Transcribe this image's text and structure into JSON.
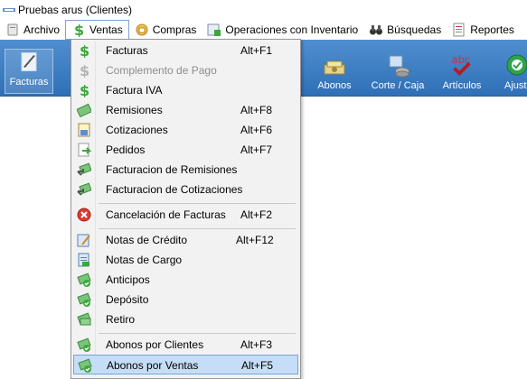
{
  "window": {
    "title": "Pruebas arus (Clientes)"
  },
  "menubar": {
    "items": [
      {
        "label": "Archivo",
        "icon": "archive-icon"
      },
      {
        "label": "Ventas",
        "icon": "dollar-icon"
      },
      {
        "label": "Compras",
        "icon": "shopping-icon"
      },
      {
        "label": "Operaciones con Inventario",
        "icon": "inventory-icon"
      },
      {
        "label": "Búsquedas",
        "icon": "binoculars-icon"
      },
      {
        "label": "Reportes",
        "icon": "report-icon"
      }
    ]
  },
  "toolbar": {
    "buttons": [
      {
        "label": "Facturas",
        "icon": "pen-icon"
      },
      {
        "label": "Abonos",
        "icon": "cash-icon"
      },
      {
        "label": "Corte / Caja",
        "icon": "register-icon"
      },
      {
        "label": "Artículos",
        "icon": "abc-check-icon"
      },
      {
        "label": "Ajust",
        "icon": "adjust-icon"
      }
    ]
  },
  "dropdown": {
    "items": [
      {
        "label": "Facturas",
        "shortcut": "Alt+F1",
        "icon": "dollar-icon"
      },
      {
        "label": "Complemento de Pago",
        "shortcut": "",
        "icon": "dollar-icon"
      },
      {
        "label": "Factura IVA",
        "shortcut": "",
        "icon": "dollar-icon"
      },
      {
        "label": "Remisiones",
        "shortcut": "Alt+F8",
        "icon": "bill-icon"
      },
      {
        "label": "Cotizaciones",
        "shortcut": "Alt+F6",
        "icon": "quote-icon"
      },
      {
        "label": "Pedidos",
        "shortcut": "Alt+F7",
        "icon": "order-icon"
      },
      {
        "label": "Facturacion de Remisiones",
        "shortcut": "",
        "icon": "convert-icon"
      },
      {
        "label": "Facturacion de Cotizaciones",
        "shortcut": "",
        "icon": "convert-icon"
      },
      {
        "label": "Cancelación de Facturas",
        "shortcut": "Alt+F2",
        "icon": "cancel-icon"
      },
      {
        "label": "Notas de Crédito",
        "shortcut": "Alt+F12",
        "icon": "credit-note-icon"
      },
      {
        "label": "Notas de Cargo",
        "shortcut": "",
        "icon": "charge-note-icon"
      },
      {
        "label": "Anticipos",
        "shortcut": "",
        "icon": "money-check-icon"
      },
      {
        "label": "Depósito",
        "shortcut": "",
        "icon": "money-check-icon"
      },
      {
        "label": "Retiro",
        "shortcut": "",
        "icon": "money-icon"
      },
      {
        "label": "Abonos por Clientes",
        "shortcut": "Alt+F3",
        "icon": "money-check-icon"
      },
      {
        "label": "Abonos por Ventas",
        "shortcut": "Alt+F5",
        "icon": "money-check-icon"
      }
    ]
  },
  "colors": {
    "toolbar_bg": "#3a7bc2",
    "highlight": "#c5ddf6",
    "dollar_green": "#3aa83a"
  }
}
